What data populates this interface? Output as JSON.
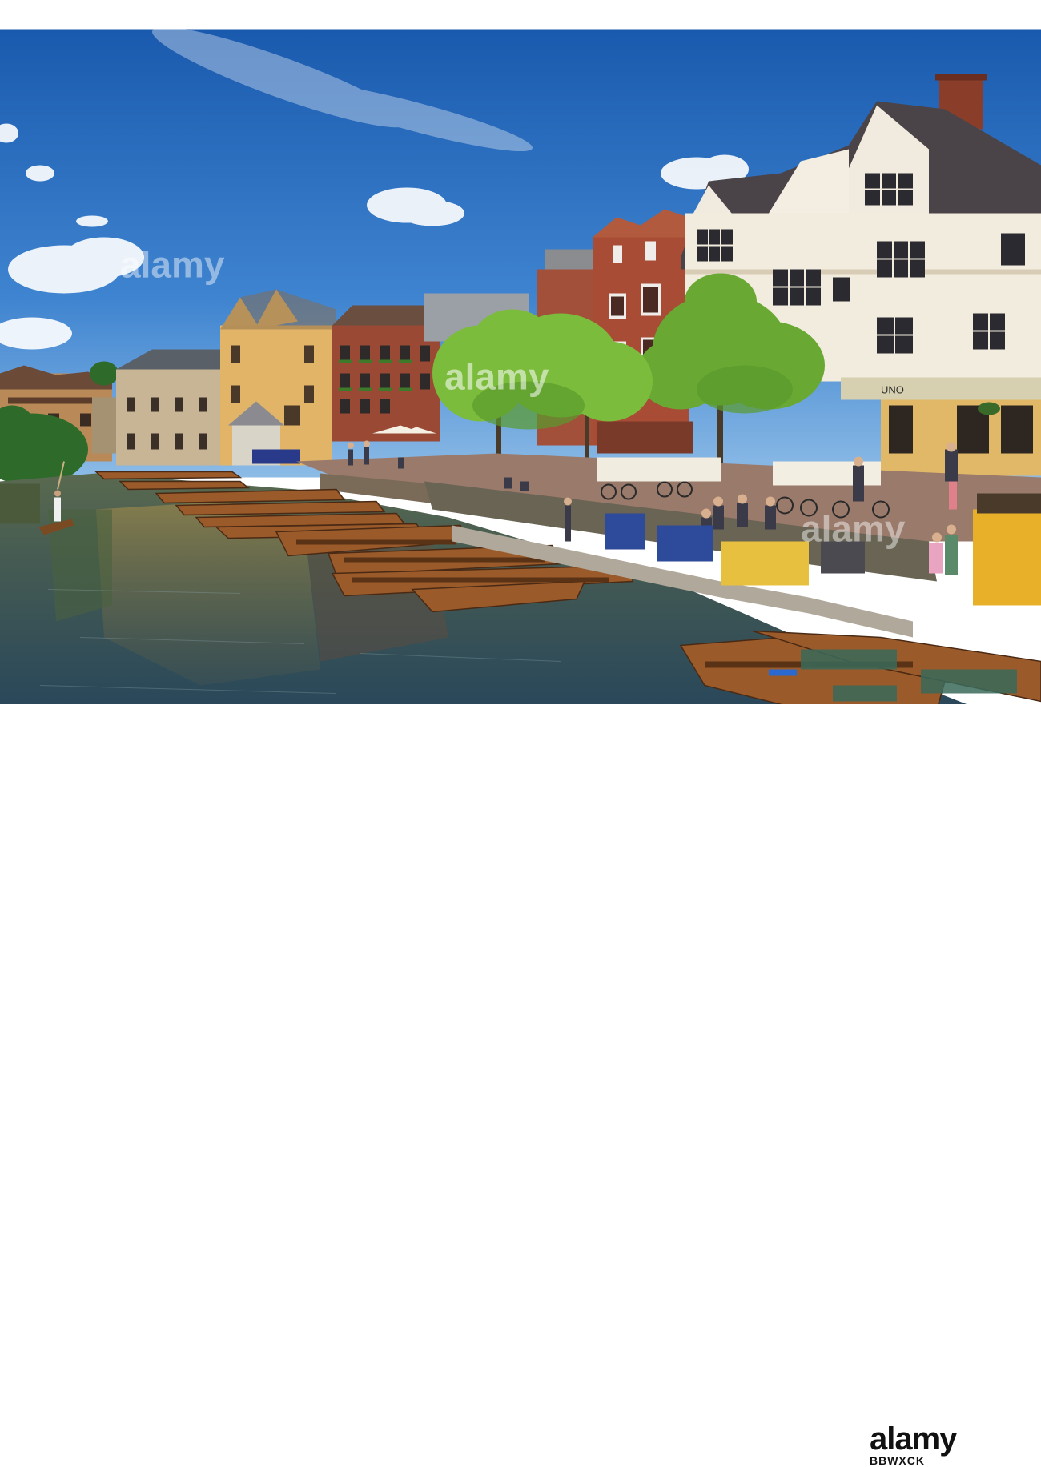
{
  "watermark": {
    "text": "alamy"
  },
  "footer": {
    "logo_text": "alamy",
    "stock_id": "BBWXCK"
  },
  "signs": {
    "cafe": "UNO"
  },
  "colors": {
    "sky_top": "#1c5fb0",
    "sky_bottom": "#78b0e4",
    "water": "#3c5c54",
    "brick": "#9a4a34",
    "stone": "#e3b86a",
    "punt": "#9a5a2a"
  }
}
